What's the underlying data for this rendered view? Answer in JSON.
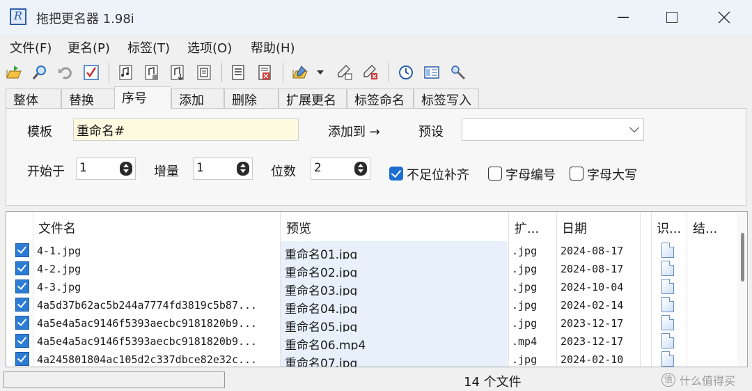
{
  "window": {
    "title": "拖把更名器 1.98i"
  },
  "menu": [
    "文件(F)",
    "更名(P)",
    "标签(T)",
    "选项(O)",
    "帮助(H)"
  ],
  "tabs": [
    "整体",
    "替换",
    "序号",
    "添加",
    "删除",
    "扩展更名",
    "标签命名",
    "标签写入"
  ],
  "active_tab": "序号",
  "panel": {
    "template_label": "模板",
    "template_value": "重命名#",
    "add_to_label": "添加到 →",
    "preset_label": "预设",
    "preset_value": "",
    "start_label": "开始于",
    "start_value": "1",
    "increment_label": "增量",
    "increment_value": "1",
    "digits_label": "位数",
    "digits_value": "2",
    "pad_label": "不足位补齐",
    "pad_checked": true,
    "letter_num_label": "字母编号",
    "letter_num_checked": false,
    "uppercase_label": "字母大写",
    "uppercase_checked": false
  },
  "columns": [
    "文件名",
    "预览",
    "扩...",
    "日期",
    "识...",
    "结..."
  ],
  "rows": [
    {
      "name": "4-1.jpg",
      "preview": "重命名01.jpg",
      "ext": ".jpg",
      "date": "2024-08-17"
    },
    {
      "name": "4-2.jpg",
      "preview": "重命名02.jpg",
      "ext": ".jpg",
      "date": "2024-08-17"
    },
    {
      "name": "4-3.jpg",
      "preview": "重命名03.jpg",
      "ext": ".jpg",
      "date": "2024-10-04"
    },
    {
      "name": "4a5d37b62ac5b244a7774fd3819c5b87...",
      "preview": "重命名04.jpg",
      "ext": ".jpg",
      "date": "2024-02-14"
    },
    {
      "name": "4a5e4a5ac9146f5393aecbc9181820b9...",
      "preview": "重命名05.jpg",
      "ext": ".jpg",
      "date": "2023-12-17"
    },
    {
      "name": "4a5e4a5ac9146f5393aecbc9181820b9...",
      "preview": "重命名06.mp4",
      "ext": ".mp4",
      "date": "2023-12-17"
    },
    {
      "name": "4a245801804ac105d2c337dbce82e32c...",
      "preview": "重命名07.jpg",
      "ext": ".jpg",
      "date": "2024-02-10"
    }
  ],
  "status": {
    "file_count": "14 个文件"
  },
  "watermark": "什么值得买",
  "colors": {
    "accent": "#1c6fd1",
    "preview_bg": "#e8f0fb",
    "template_bg": "#fffbe0"
  }
}
